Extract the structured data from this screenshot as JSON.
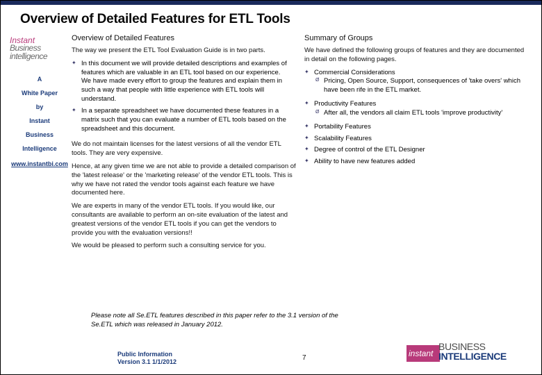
{
  "title": "Overview of Detailed Features for ETL Tools",
  "sidebar": {
    "logo": {
      "t1": "Instant",
      "t2": "Business",
      "t3": "intelligence"
    },
    "lines": [
      "A",
      "White Paper",
      "by",
      "Instant",
      "Business",
      "Intelligence"
    ],
    "link": "www.instantbi.com"
  },
  "left": {
    "heading": "Overview of Detailed Features",
    "intro": "The way we present the ETL Tool Evaluation Guide is in two parts.",
    "bul1": "In this document we will provide detailed descriptions and examples of features which are valuable in an ETL tool based on our experience.\nWe have made every effort to group the features and explain them in such a way that people with little experience with ETL tools will understand.",
    "bul2": "In a separate spreadsheet we have documented these features in a matrix such that you can evaluate a number of ETL tools based on the spreadsheet and this document.",
    "p1": "We do not maintain licenses for the latest versions of all the vendor ETL tools. They are very expensive.",
    "p2": "Hence, at any given time we are not able to provide a detailed comparison of the 'latest release' or the 'marketing release' of the vendor ETL tools. This is why we have not rated the vendor tools against each feature we have documented here.",
    "p3": "We are experts in many of the vendor ETL tools. If you would like, our consultants are available to perform an on-site evaluation of the latest and greatest versions of the vendor ETL tools if you can get the vendors to provide you with the evaluation versions!!",
    "p4": "We would be pleased to perform such a consulting service for you."
  },
  "right": {
    "heading": "Summary of Groups",
    "intro": "We have defined the following groups of features and they are documented in detail on the following pages.",
    "groups": [
      {
        "label": "Commercial Considerations",
        "sub": "Pricing, Open Source, Support, consequences of 'take overs' which have been rife in the ETL market."
      },
      {
        "label": "Productivity Features",
        "sub": "After all, the vendors all claim ETL tools 'improve productivity'"
      },
      {
        "label": "Portability Features"
      },
      {
        "label": "Scalability Features"
      },
      {
        "label": "Degree of control of the ETL Designer"
      },
      {
        "label": "Ability to have new features added"
      }
    ]
  },
  "note": "Please note all Se.ETL features described in this paper refer to the 3.1 version of the Se.ETL which was released in January 2012.",
  "pub": {
    "l1": "Public Information",
    "l2": "Version 3.1  1/1/2012"
  },
  "pagenum": "7",
  "footlogo": {
    "box": "instant",
    "big1": "BUSINESS",
    "big2": "INTELLIGENCE"
  }
}
